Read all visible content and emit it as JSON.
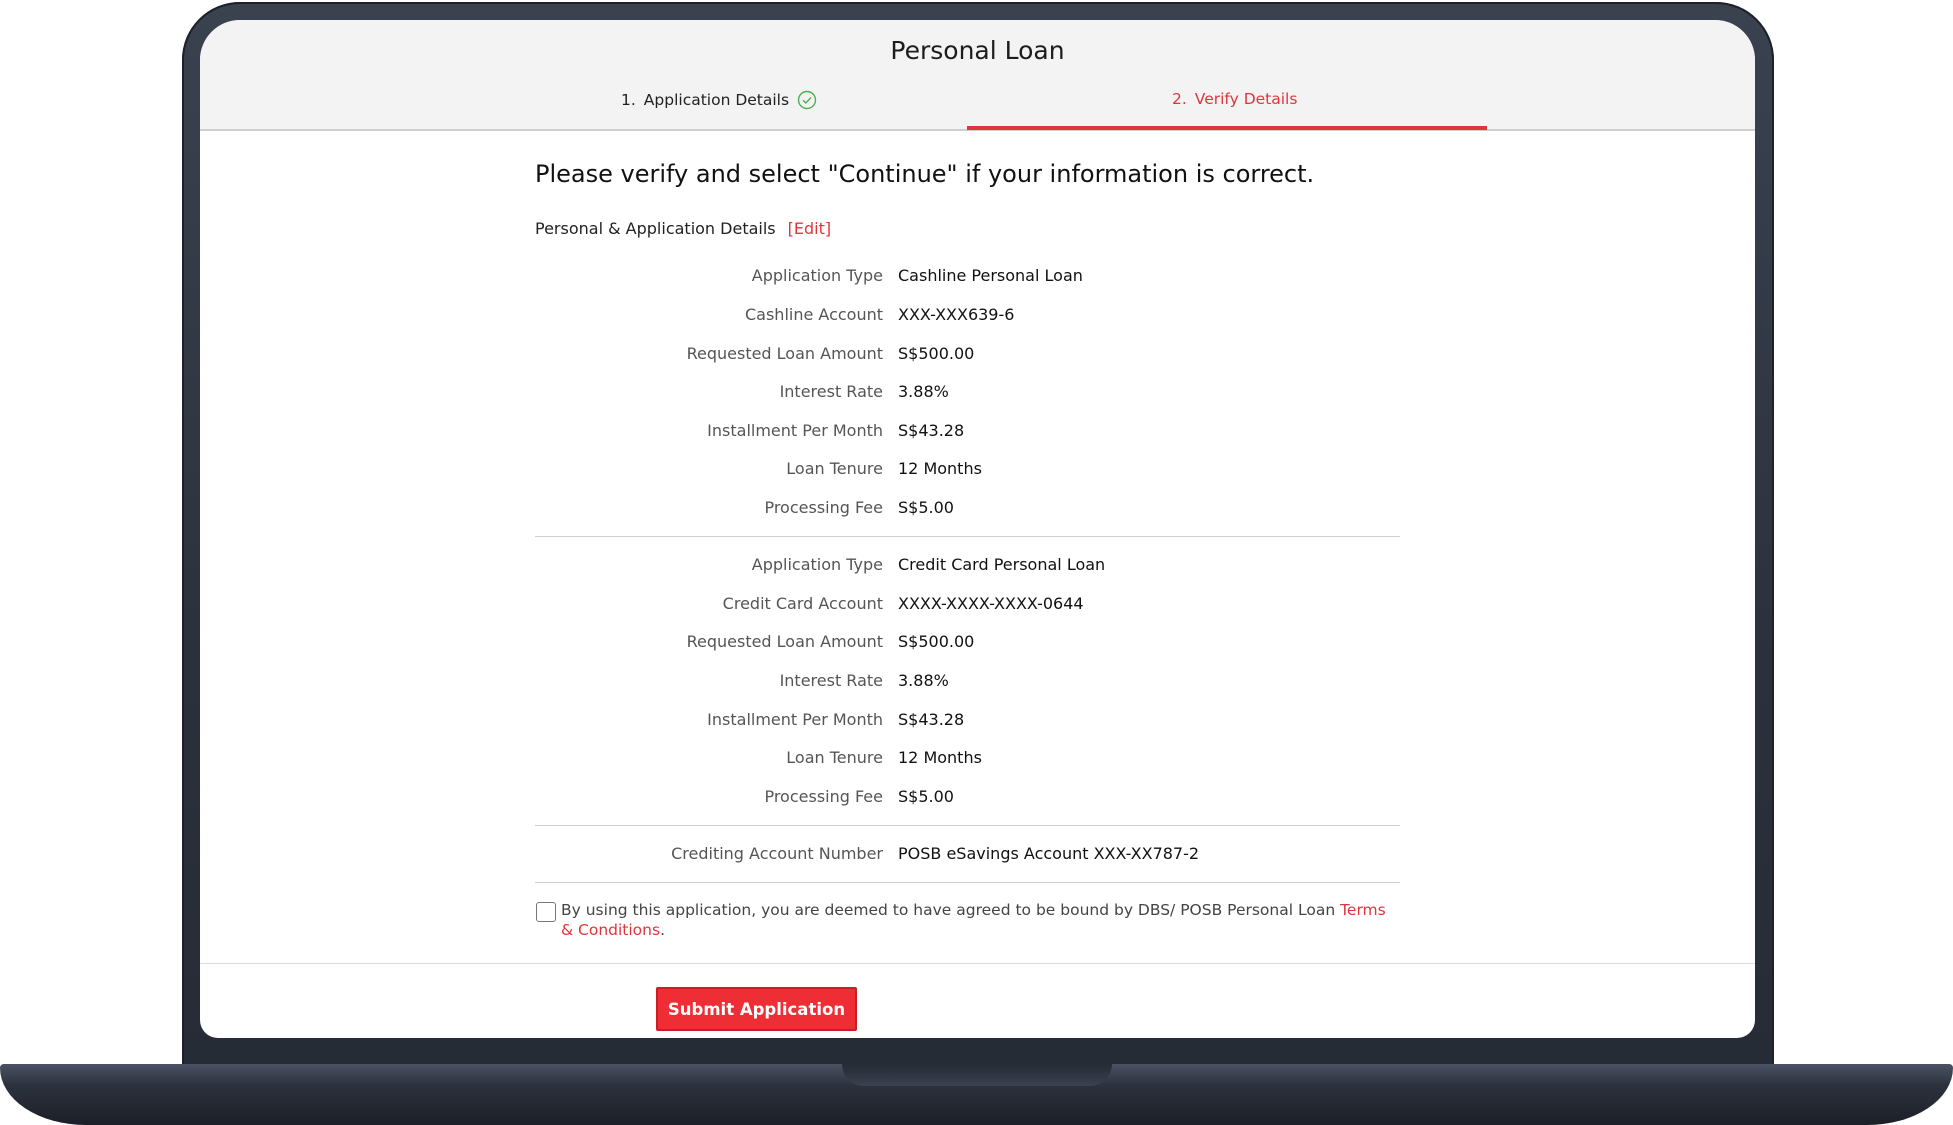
{
  "app": {
    "title": "Personal Loan"
  },
  "steps": [
    {
      "number": "1.",
      "label": "Application Details",
      "status": "completed",
      "icon": "check-circle-icon"
    },
    {
      "number": "2.",
      "label": "Verify Details",
      "status": "active"
    }
  ],
  "headline": "Please verify and select \"Continue\" if your information is correct.",
  "section": {
    "label": "Personal & Application Details",
    "edit_label": "[Edit]"
  },
  "cashline": [
    {
      "label": "Application Type",
      "value": "Cashline Personal Loan"
    },
    {
      "label": "Cashline Account",
      "value": "XXX-XXX639-6"
    },
    {
      "label": "Requested Loan Amount",
      "value": "S$500.00"
    },
    {
      "label": "Interest Rate",
      "value": "3.88%"
    },
    {
      "label": "Installment Per Month",
      "value": "S$43.28"
    },
    {
      "label": "Loan Tenure",
      "value": "12 Months"
    },
    {
      "label": "Processing Fee",
      "value": "S$5.00"
    }
  ],
  "creditcard": [
    {
      "label": "Application Type",
      "value": "Credit Card Personal Loan"
    },
    {
      "label": "Credit Card Account",
      "value": "XXXX-XXXX-XXXX-0644"
    },
    {
      "label": "Requested Loan Amount",
      "value": "S$500.00"
    },
    {
      "label": "Interest Rate",
      "value": "3.88%"
    },
    {
      "label": "Installment Per Month",
      "value": "S$43.28"
    },
    {
      "label": "Loan Tenure",
      "value": "12 Months"
    },
    {
      "label": "Processing Fee",
      "value": "S$5.00"
    }
  ],
  "crediting": {
    "label": "Crediting Account Number",
    "value": "POSB eSavings Account XXX-XX787-2"
  },
  "agreement": {
    "text": "By using this application, you are deemed to have agreed to be bound by DBS/ POSB Personal Loan ",
    "link_text": "Terms & Conditions",
    "suffix": ".",
    "checked": false
  },
  "submit_label": "Submit Application",
  "colors": {
    "accent": "#e0353b",
    "button": "#ee2d35"
  }
}
